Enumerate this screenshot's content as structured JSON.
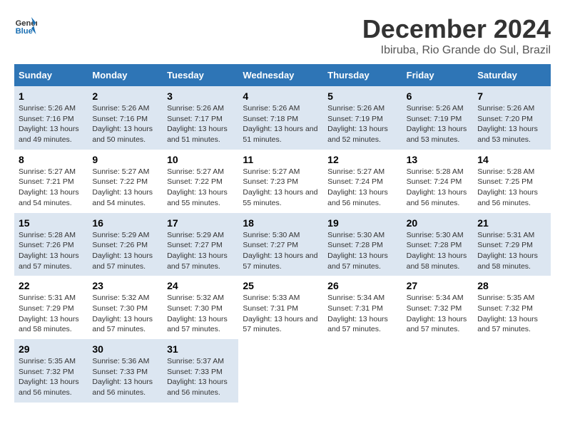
{
  "logo": {
    "text_general": "General",
    "text_blue": "Blue"
  },
  "title": "December 2024",
  "subtitle": "Ibiruba, Rio Grande do Sul, Brazil",
  "days_of_week": [
    "Sunday",
    "Monday",
    "Tuesday",
    "Wednesday",
    "Thursday",
    "Friday",
    "Saturday"
  ],
  "weeks": [
    [
      {
        "day": "1",
        "sunrise": "Sunrise: 5:26 AM",
        "sunset": "Sunset: 7:16 PM",
        "daylight": "Daylight: 13 hours and 49 minutes."
      },
      {
        "day": "2",
        "sunrise": "Sunrise: 5:26 AM",
        "sunset": "Sunset: 7:16 PM",
        "daylight": "Daylight: 13 hours and 50 minutes."
      },
      {
        "day": "3",
        "sunrise": "Sunrise: 5:26 AM",
        "sunset": "Sunset: 7:17 PM",
        "daylight": "Daylight: 13 hours and 51 minutes."
      },
      {
        "day": "4",
        "sunrise": "Sunrise: 5:26 AM",
        "sunset": "Sunset: 7:18 PM",
        "daylight": "Daylight: 13 hours and 51 minutes."
      },
      {
        "day": "5",
        "sunrise": "Sunrise: 5:26 AM",
        "sunset": "Sunset: 7:19 PM",
        "daylight": "Daylight: 13 hours and 52 minutes."
      },
      {
        "day": "6",
        "sunrise": "Sunrise: 5:26 AM",
        "sunset": "Sunset: 7:19 PM",
        "daylight": "Daylight: 13 hours and 53 minutes."
      },
      {
        "day": "7",
        "sunrise": "Sunrise: 5:26 AM",
        "sunset": "Sunset: 7:20 PM",
        "daylight": "Daylight: 13 hours and 53 minutes."
      }
    ],
    [
      {
        "day": "8",
        "sunrise": "Sunrise: 5:27 AM",
        "sunset": "Sunset: 7:21 PM",
        "daylight": "Daylight: 13 hours and 54 minutes."
      },
      {
        "day": "9",
        "sunrise": "Sunrise: 5:27 AM",
        "sunset": "Sunset: 7:22 PM",
        "daylight": "Daylight: 13 hours and 54 minutes."
      },
      {
        "day": "10",
        "sunrise": "Sunrise: 5:27 AM",
        "sunset": "Sunset: 7:22 PM",
        "daylight": "Daylight: 13 hours and 55 minutes."
      },
      {
        "day": "11",
        "sunrise": "Sunrise: 5:27 AM",
        "sunset": "Sunset: 7:23 PM",
        "daylight": "Daylight: 13 hours and 55 minutes."
      },
      {
        "day": "12",
        "sunrise": "Sunrise: 5:27 AM",
        "sunset": "Sunset: 7:24 PM",
        "daylight": "Daylight: 13 hours and 56 minutes."
      },
      {
        "day": "13",
        "sunrise": "Sunrise: 5:28 AM",
        "sunset": "Sunset: 7:24 PM",
        "daylight": "Daylight: 13 hours and 56 minutes."
      },
      {
        "day": "14",
        "sunrise": "Sunrise: 5:28 AM",
        "sunset": "Sunset: 7:25 PM",
        "daylight": "Daylight: 13 hours and 56 minutes."
      }
    ],
    [
      {
        "day": "15",
        "sunrise": "Sunrise: 5:28 AM",
        "sunset": "Sunset: 7:26 PM",
        "daylight": "Daylight: 13 hours and 57 minutes."
      },
      {
        "day": "16",
        "sunrise": "Sunrise: 5:29 AM",
        "sunset": "Sunset: 7:26 PM",
        "daylight": "Daylight: 13 hours and 57 minutes."
      },
      {
        "day": "17",
        "sunrise": "Sunrise: 5:29 AM",
        "sunset": "Sunset: 7:27 PM",
        "daylight": "Daylight: 13 hours and 57 minutes."
      },
      {
        "day": "18",
        "sunrise": "Sunrise: 5:30 AM",
        "sunset": "Sunset: 7:27 PM",
        "daylight": "Daylight: 13 hours and 57 minutes."
      },
      {
        "day": "19",
        "sunrise": "Sunrise: 5:30 AM",
        "sunset": "Sunset: 7:28 PM",
        "daylight": "Daylight: 13 hours and 57 minutes."
      },
      {
        "day": "20",
        "sunrise": "Sunrise: 5:30 AM",
        "sunset": "Sunset: 7:28 PM",
        "daylight": "Daylight: 13 hours and 58 minutes."
      },
      {
        "day": "21",
        "sunrise": "Sunrise: 5:31 AM",
        "sunset": "Sunset: 7:29 PM",
        "daylight": "Daylight: 13 hours and 58 minutes."
      }
    ],
    [
      {
        "day": "22",
        "sunrise": "Sunrise: 5:31 AM",
        "sunset": "Sunset: 7:29 PM",
        "daylight": "Daylight: 13 hours and 58 minutes."
      },
      {
        "day": "23",
        "sunrise": "Sunrise: 5:32 AM",
        "sunset": "Sunset: 7:30 PM",
        "daylight": "Daylight: 13 hours and 57 minutes."
      },
      {
        "day": "24",
        "sunrise": "Sunrise: 5:32 AM",
        "sunset": "Sunset: 7:30 PM",
        "daylight": "Daylight: 13 hours and 57 minutes."
      },
      {
        "day": "25",
        "sunrise": "Sunrise: 5:33 AM",
        "sunset": "Sunset: 7:31 PM",
        "daylight": "Daylight: 13 hours and 57 minutes."
      },
      {
        "day": "26",
        "sunrise": "Sunrise: 5:34 AM",
        "sunset": "Sunset: 7:31 PM",
        "daylight": "Daylight: 13 hours and 57 minutes."
      },
      {
        "day": "27",
        "sunrise": "Sunrise: 5:34 AM",
        "sunset": "Sunset: 7:32 PM",
        "daylight": "Daylight: 13 hours and 57 minutes."
      },
      {
        "day": "28",
        "sunrise": "Sunrise: 5:35 AM",
        "sunset": "Sunset: 7:32 PM",
        "daylight": "Daylight: 13 hours and 57 minutes."
      }
    ],
    [
      {
        "day": "29",
        "sunrise": "Sunrise: 5:35 AM",
        "sunset": "Sunset: 7:32 PM",
        "daylight": "Daylight: 13 hours and 56 minutes."
      },
      {
        "day": "30",
        "sunrise": "Sunrise: 5:36 AM",
        "sunset": "Sunset: 7:33 PM",
        "daylight": "Daylight: 13 hours and 56 minutes."
      },
      {
        "day": "31",
        "sunrise": "Sunrise: 5:37 AM",
        "sunset": "Sunset: 7:33 PM",
        "daylight": "Daylight: 13 hours and 56 minutes."
      },
      null,
      null,
      null,
      null
    ]
  ]
}
